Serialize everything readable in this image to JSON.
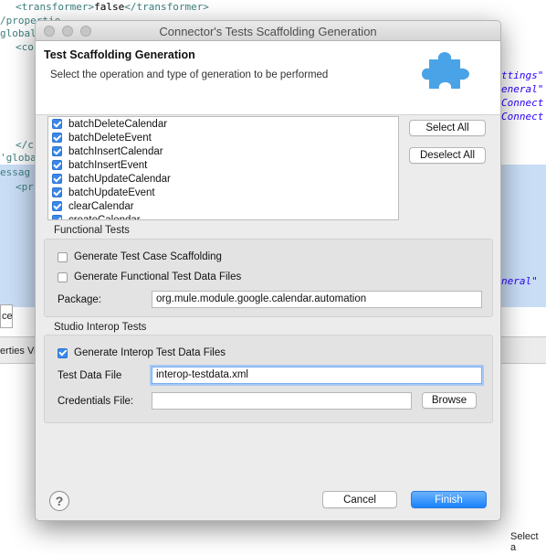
{
  "background": {
    "code_lines": [
      {
        "tag": "<transformer>",
        "text": "false",
        "end": "</transformer>"
      },
      {
        "text": "/propertie"
      },
      {
        "text": "global"
      },
      {
        "text": "<co"
      },
      {
        "text": "</c"
      },
      {
        "text": "'globa"
      },
      {
        "text": "essag"
      },
      {
        "text": "<pr"
      }
    ],
    "right_fragments": [
      "ttings\"",
      "eneral\"",
      "Connect",
      "Connect",
      "neral\" "
    ],
    "editor_tab_label": "ce",
    "panel_label": "erties Vi",
    "bottom_label": "Select a"
  },
  "dialog": {
    "title": "Connector's Tests Scaffolding Generation",
    "banner": {
      "title": "Test Scaffolding Generation",
      "description": "Select the operation and type of generation to be performed",
      "icon": "puzzle-icon",
      "accent_color": "#4aa3e6"
    },
    "operations": [
      {
        "label": "batchDeleteCalendar",
        "checked": true
      },
      {
        "label": "batchDeleteEvent",
        "checked": true
      },
      {
        "label": "batchInsertCalendar",
        "checked": true
      },
      {
        "label": "batchInsertEvent",
        "checked": true
      },
      {
        "label": "batchUpdateCalendar",
        "checked": true
      },
      {
        "label": "batchUpdateEvent",
        "checked": true
      },
      {
        "label": "clearCalendar",
        "checked": true
      },
      {
        "label": "createCalendar",
        "checked": true
      }
    ],
    "select_all_label": "Select All",
    "deselect_all_label": "Deselect All",
    "functional_tests": {
      "label": "Functional Tests",
      "generate_test_case_label": "Generate Test Case Scaffolding",
      "generate_test_case_checked": false,
      "generate_data_files_label": "Generate Functional Test Data Files",
      "generate_data_files_checked": false,
      "package_label": "Package:",
      "package_value": "org.mule.module.google.calendar.automation"
    },
    "interop_tests": {
      "label": "Studio Interop Tests",
      "generate_label": "Generate Interop Test Data Files",
      "generate_checked": true,
      "test_data_file_label": "Test Data File",
      "test_data_file_value": "interop-testdata.xml",
      "credentials_label": "Credentials File:",
      "credentials_value": "",
      "browse_label": "Browse"
    },
    "help_icon": "?",
    "cancel_label": "Cancel",
    "finish_label": "Finish",
    "primary_color": "#1a82fb"
  }
}
